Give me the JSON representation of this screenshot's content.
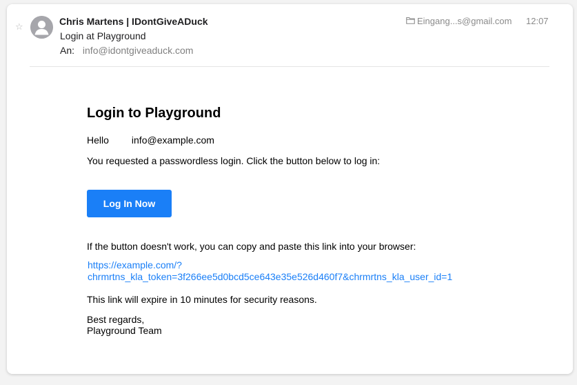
{
  "header": {
    "sender": "Chris Martens | IDontGiveADuck",
    "subject": "Login at Playground",
    "to_label": "An:",
    "to_address": "info@idontgiveaduck.com",
    "mailbox": "Eingang...s@gmail.com",
    "time": "12:07"
  },
  "email": {
    "title": "Login to Playground",
    "greeting": "Hello",
    "greeting_email": "info@example.com",
    "request_text": "You requested a passwordless login. Click the button below to log in:",
    "button_label": "Log In Now",
    "fallback_text": "If the button doesn't work, you can copy and paste this link into your browser:",
    "link_line1": "https://example.com/?",
    "link_line2": "chrmrtns_kla_token=3f266ee5d0bcd5ce643e35e526d460f7&chrmrtns_kla_user_id=1",
    "expire_text": "This link will expire in 10 minutes for security reasons.",
    "signoff": "Best regards,",
    "signature": "Playground Team"
  },
  "colors": {
    "accent": "#1a7ff7",
    "muted": "#8a8a8a"
  },
  "icons": [
    "star-icon",
    "avatar-icon",
    "folder-icon"
  ]
}
